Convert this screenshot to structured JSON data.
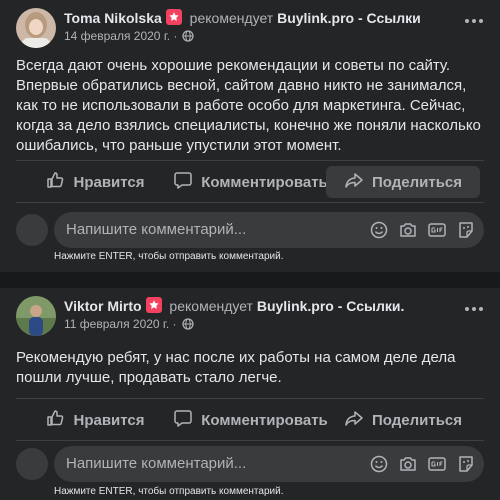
{
  "posts": [
    {
      "author": "Toma Nikolska",
      "recommends": "рекомендует",
      "page": "Buylink.pro - Ссылки",
      "date": "14 февраля 2020 г. ·",
      "text": "Всегда дают очень хорошие рекомендации и советы по сайту. Впервые обратились весной, сайтом давно никто не занимался, как то не использовали в работе особо для маркетинга. Сейчас, когда за дело взялись специалисты, конечно же поняли насколько ошибались, что раньше упустили этот момент.",
      "like_label": "Нравится",
      "comment_label": "Комментировать",
      "share_label": "Поделиться",
      "comment_placeholder": "Напишите комментарий...",
      "hint": "Нажмите ENTER, чтобы отправить комментарий."
    },
    {
      "author": "Viktor Mirto",
      "recommends": "рекомендует",
      "page": "Buylink.pro - Ссылки.",
      "date": "11 февраля 2020 г. ·",
      "text": "Рекомендую ребят, у нас после их работы на самом деле дела пошли лучше, продавать стало легче.",
      "like_label": "Нравится",
      "comment_label": "Комментировать",
      "share_label": "Поделиться",
      "comment_placeholder": "Напишите комментарий...",
      "hint": "Нажмите ENTER, чтобы отправить комментарий."
    }
  ],
  "colors": {
    "background": "#18191a",
    "card": "#242526",
    "input": "#3a3b3c",
    "text_primary": "#e4e6eb",
    "text_secondary": "#b0b3b8",
    "recommend_badge": "#f3425f"
  },
  "icons": {
    "like": "thumbs-up-icon",
    "comment": "speech-bubble-icon",
    "share": "share-arrow-icon",
    "audience": "globe-icon",
    "more": "more-dots-icon",
    "badge": "recommend-badge-icon",
    "comment_tools": [
      "emoji-icon",
      "camera-icon",
      "gif-icon",
      "sticker-icon"
    ]
  }
}
